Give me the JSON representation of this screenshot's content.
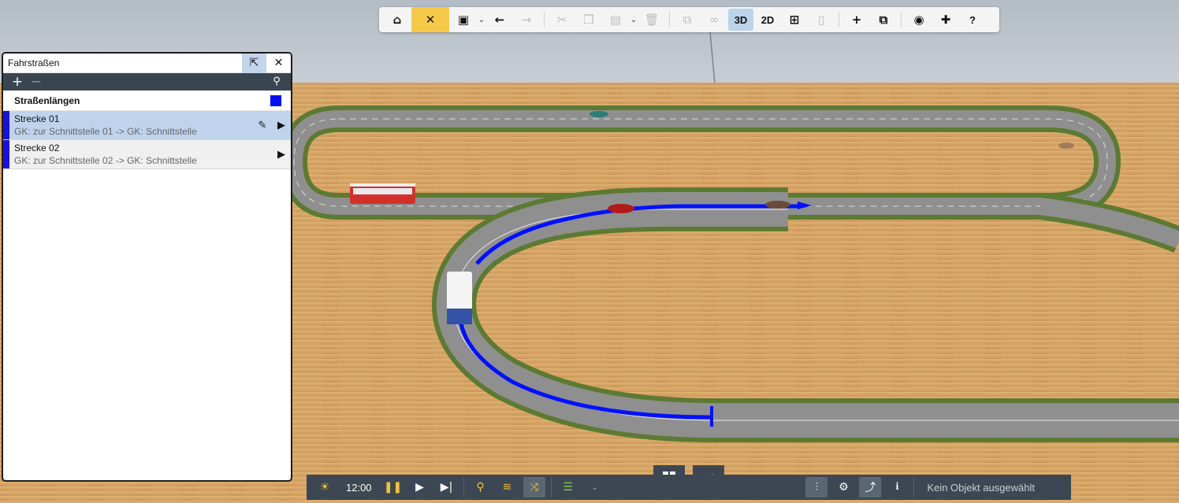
{
  "toolbar": {
    "home_icon": "home-icon",
    "tools_icon": "tools-icon",
    "save_icon": "save-icon",
    "undo_icon": "arrow-left-icon",
    "redo_icon": "arrow-right-icon",
    "cut_icon": "cut-icon",
    "copy_icon": "copy-icon",
    "paste_icon": "paste-icon",
    "delete_icon": "trash-icon",
    "group_icon": "group-icon",
    "link_icon": "link-icon",
    "view_3d": "3D",
    "view_2d": "2D",
    "grid_icon": "grid-icon",
    "train_icon": "train-icon",
    "add_icon": "plus-icon",
    "window_icon": "window-icon",
    "camera_icon": "camera-icon",
    "plugin_icon": "puzzle-icon",
    "help_label": "?"
  },
  "panel": {
    "title": "Fahrstraßen",
    "group": {
      "label": "Straßenlängen",
      "color": "#0010ff"
    },
    "routes": [
      {
        "name": "Strecke 01",
        "description": "GK: zur Schnittstelle 01 -> GK: Schnittstelle",
        "selected": true
      },
      {
        "name": "Strecke 02",
        "description": "GK: zur Schnittstelle 02 -> GK: Schnittstelle",
        "selected": false
      }
    ]
  },
  "bottom": {
    "time": "12:00",
    "status": "Kein Objekt ausgewählt",
    "info_label": "i"
  },
  "colors": {
    "route_highlight": "#0010ff",
    "ground": "#d6a464",
    "road": "#8c8c8c",
    "grass": "#5c7a32",
    "accent_yellow": "#f7c948"
  }
}
